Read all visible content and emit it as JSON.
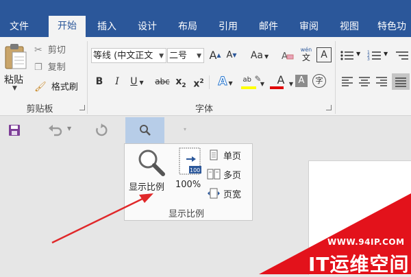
{
  "tabs": [
    {
      "label": "文件",
      "active": false
    },
    {
      "label": "开始",
      "active": true
    },
    {
      "label": "插入",
      "active": false
    },
    {
      "label": "设计",
      "active": false
    },
    {
      "label": "布局",
      "active": false
    },
    {
      "label": "引用",
      "active": false
    },
    {
      "label": "邮件",
      "active": false
    },
    {
      "label": "审阅",
      "active": false
    },
    {
      "label": "视图",
      "active": false
    },
    {
      "label": "特色功",
      "active": false
    }
  ],
  "clipboard": {
    "paste_label": "粘贴",
    "cut_label": "剪切",
    "copy_label": "复制",
    "format_painter_label": "格式刷",
    "group_label": "剪贴板"
  },
  "font": {
    "font_name": "等线 (中文正文",
    "font_size": "二号",
    "group_label": "字体",
    "grow_label": "A",
    "shrink_label": "A",
    "case_label": "Aa",
    "phonetic_top": "wén",
    "phonetic_bottom": "文",
    "border_char_label": "A",
    "bold": "B",
    "italic": "I",
    "underline": "U",
    "strike": "abc",
    "sub": "x",
    "sub_mark": "2",
    "sup": "x",
    "sup_mark": "2",
    "effects_label": "A",
    "highlight_label": "ab",
    "font_color_label": "A",
    "shading_label": "A",
    "enclose_label": "字"
  },
  "zoom_panel": {
    "zoom_label": "显示比例",
    "hundred_label": "100%",
    "hundred_icon_text": "100",
    "one_page_label": "单页",
    "multi_page_label": "多页",
    "page_width_label": "页宽",
    "group_label": "显示比例"
  },
  "watermark": {
    "site": "WWW.94IP.COM",
    "brand": "IT运维空间"
  },
  "colors": {
    "tab_bar": "#2b579a",
    "ribbon": "#f3f3f3",
    "workspace": "#e6e6e6",
    "zoom_highlight": "#b7cde8",
    "arrow": "#e0282a",
    "font_color_bar": "#e00000",
    "highlight_bar": "#ffff00"
  }
}
